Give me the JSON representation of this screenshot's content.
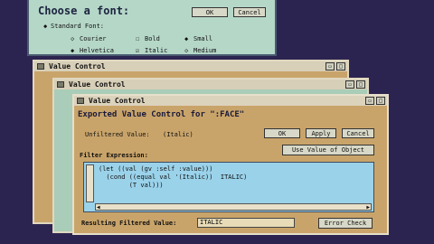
{
  "font_dialog": {
    "title": "Choose a font:",
    "ok": "OK",
    "cancel": "Cancel",
    "standard_fonts": "Standard Font:",
    "options": [
      "Courier",
      "Bold",
      "Small",
      "Helvetica",
      "Italic",
      "Medium"
    ]
  },
  "win_back": {
    "title": "Value Control"
  },
  "win_middle": {
    "title": "Value Control"
  },
  "win_front": {
    "title": "Value Control",
    "heading": "Exported Value Control for \":FACE\"",
    "unfiltered_label": "Unfiltered Value:",
    "unfiltered_value": "(Italic)",
    "ok": "OK",
    "apply": "Apply",
    "cancel": "Cancel",
    "use_value": "Use Value of Object",
    "filter_label": "Filter Expression:",
    "code": [
      "(let ((val (gv :self :value)))",
      "  (cond ((equal val '(Italic))  ITALIC)",
      "        (T val)))"
    ],
    "result_label": "Resulting Filtered Value:",
    "result_value": "ITALIC",
    "error_check": "Error Check"
  },
  "colors": {
    "frame": "#d6c8a4",
    "panel": "#c9a46a",
    "text_area": "#9ad2ea",
    "teal": "#a9cdb8",
    "background": "#2c2450"
  }
}
